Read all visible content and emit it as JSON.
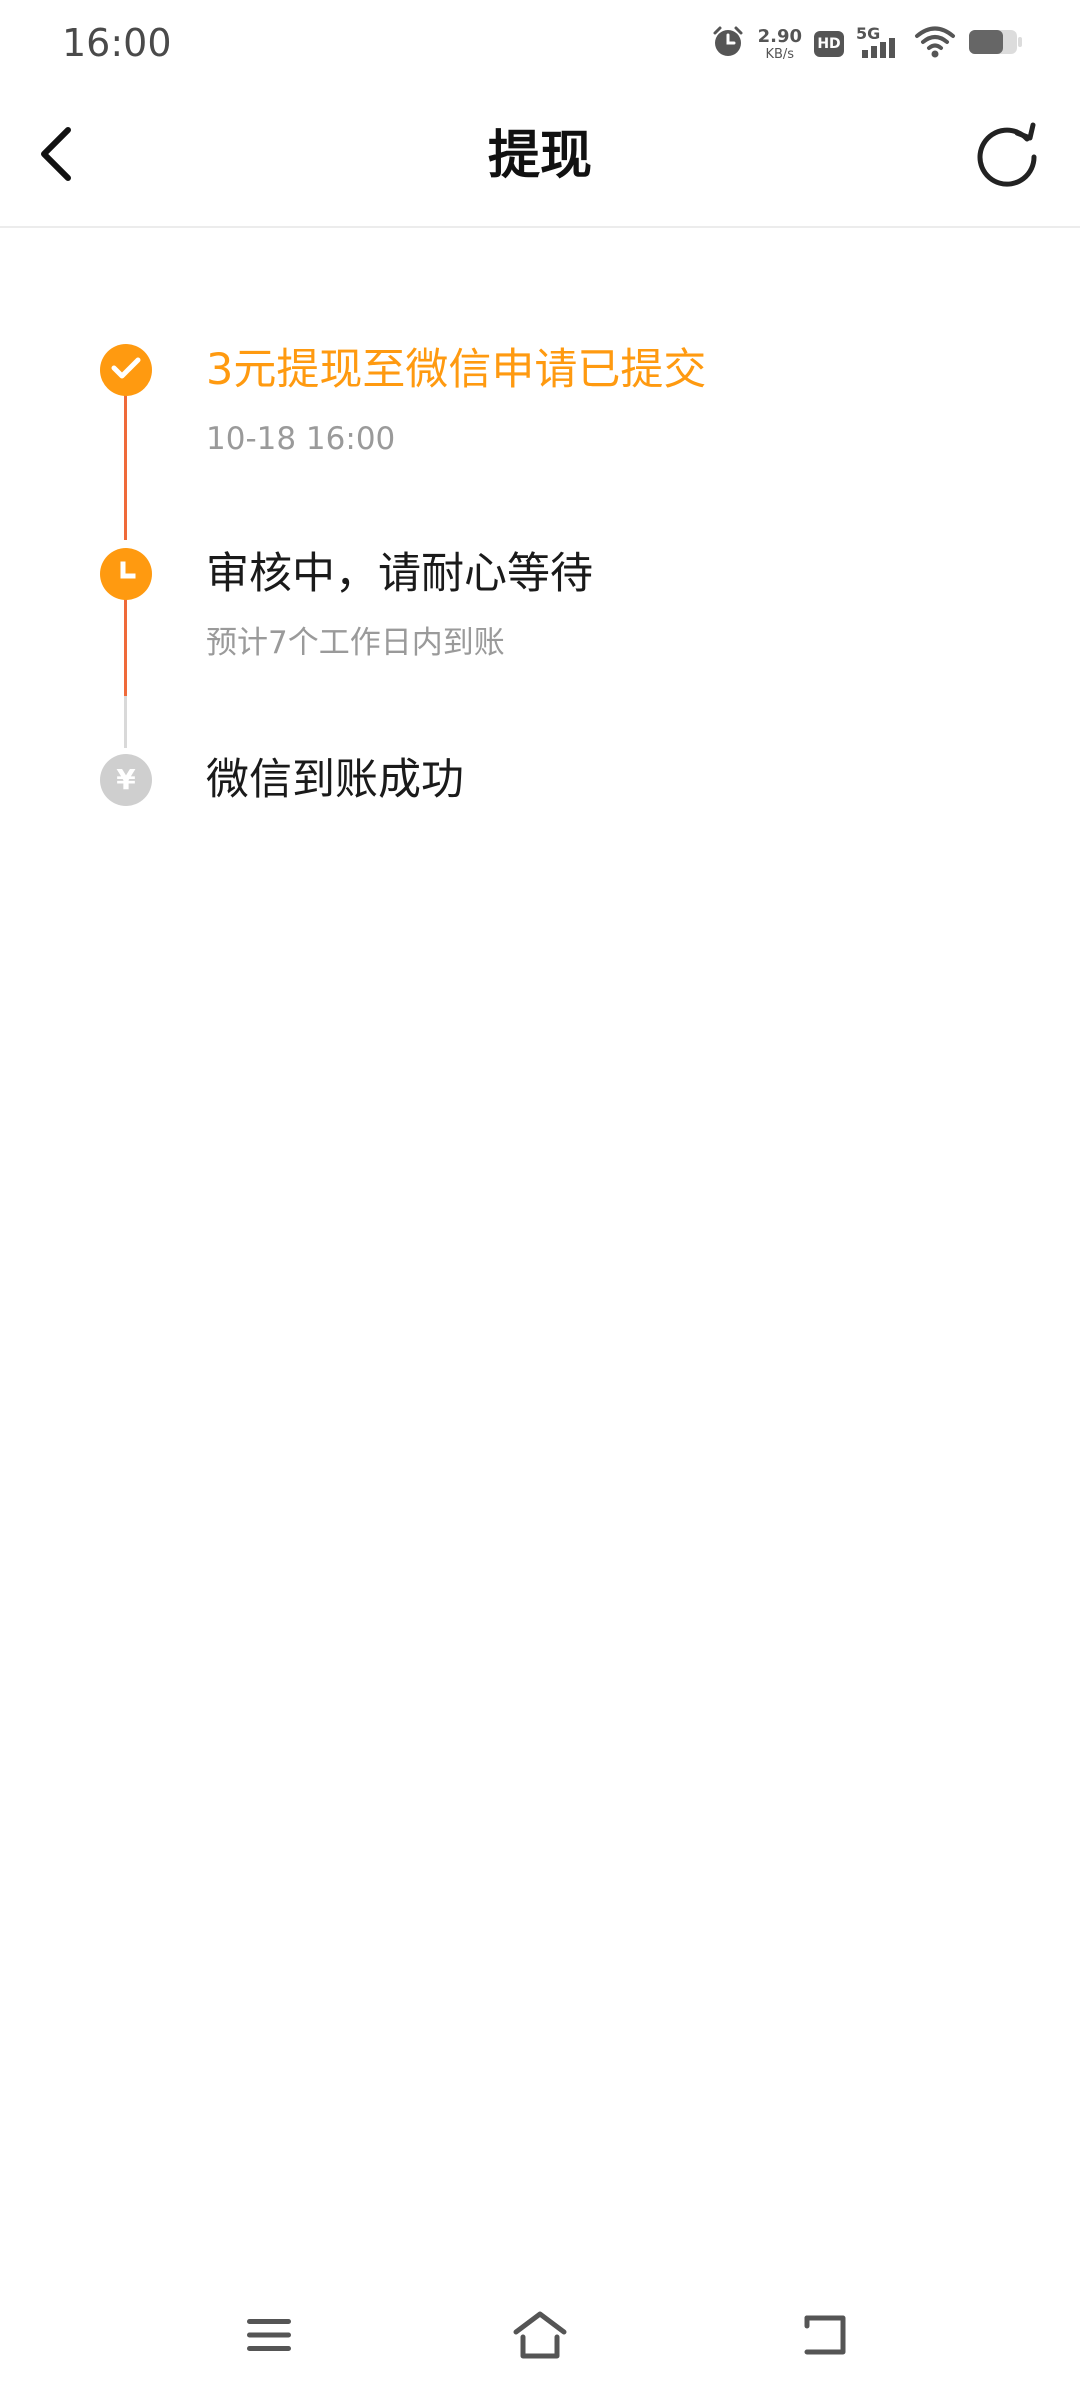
{
  "status_bar": {
    "time": "16:00",
    "net_speed_value": "2.90",
    "net_speed_unit": "KB/s",
    "hd_label": "HD",
    "network_label": "5G"
  },
  "header": {
    "title": "提现"
  },
  "timeline": {
    "steps": [
      {
        "title": "3元提现至微信申请已提交",
        "subtitle": "10-18 16:00",
        "status": "done",
        "icon": "check-icon"
      },
      {
        "title": "审核中，请耐心等待",
        "subtitle": "预计7个工作日内到账",
        "status": "current",
        "icon": "clock-icon"
      },
      {
        "title": "微信到账成功",
        "status": "pending",
        "icon": "yen-icon",
        "icon_glyph": "¥"
      }
    ]
  },
  "colors": {
    "accent": "#ff9a10",
    "line_active": "#ef6a3a",
    "line_inactive": "#d9d9d9",
    "node_inactive": "#cfcfcf"
  }
}
